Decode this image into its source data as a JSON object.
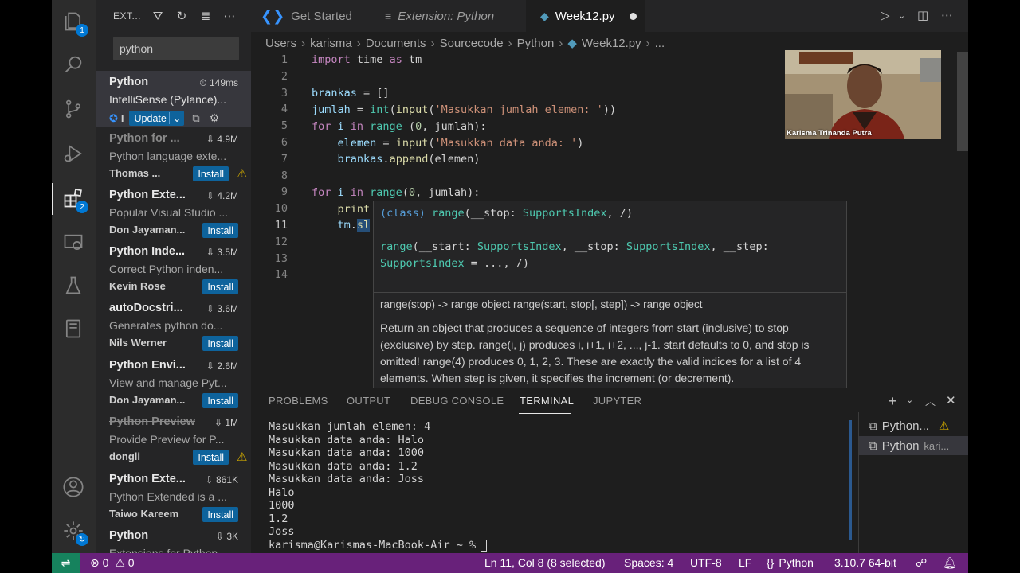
{
  "sidebar": {
    "title": "EXT...",
    "search": "python",
    "extensions": [
      {
        "name": "Python",
        "stat": "149ms",
        "desc": "IntelliSense (Pylance)...",
        "publisher": "I",
        "button": "Update",
        "selected": true,
        "strike": false,
        "warn": false
      },
      {
        "name": "Python for ...",
        "stat": "4.9M",
        "desc": "Python language exte...",
        "publisher": "Thomas ...",
        "button": "Install",
        "selected": false,
        "strike": true,
        "warn": true
      },
      {
        "name": "Python Exte...",
        "stat": "4.2M",
        "desc": "Popular Visual Studio ...",
        "publisher": "Don Jayaman...",
        "button": "Install",
        "selected": false,
        "strike": false,
        "warn": false
      },
      {
        "name": "Python Inde...",
        "stat": "3.5M",
        "desc": "Correct Python inden...",
        "publisher": "Kevin Rose",
        "button": "Install",
        "selected": false,
        "strike": false,
        "warn": false
      },
      {
        "name": "autoDocstri...",
        "stat": "3.6M",
        "desc": "Generates python do...",
        "publisher": "Nils Werner",
        "button": "Install",
        "selected": false,
        "strike": false,
        "warn": false
      },
      {
        "name": "Python Envi...",
        "stat": "2.6M",
        "desc": "View and manage Pyt...",
        "publisher": "Don Jayaman...",
        "button": "Install",
        "selected": false,
        "strike": false,
        "warn": false
      },
      {
        "name": "Python Preview",
        "stat": "1M",
        "desc": "Provide Preview for P...",
        "publisher": "dongli",
        "button": "Install",
        "selected": false,
        "strike": true,
        "warn": true
      },
      {
        "name": "Python Exte...",
        "stat": "861K",
        "desc": "Python Extended is a ...",
        "publisher": "Taiwo Kareem",
        "button": "Install",
        "selected": false,
        "strike": false,
        "warn": false
      },
      {
        "name": "Python",
        "stat": "3K",
        "desc": "Extensions for Python",
        "publisher": "",
        "button": "",
        "selected": false,
        "strike": false,
        "warn": false
      }
    ]
  },
  "activity": {
    "badge_explorer": "1",
    "badge_extensions": "2"
  },
  "tabs": {
    "tab1": "Get Started",
    "tab2": "Extension: Python",
    "tab3": "Week12.py"
  },
  "breadcrumb": [
    "Users",
    "karisma",
    "Documents",
    "Sourcecode",
    "Python",
    "Week12.py",
    "..."
  ],
  "line_numbers": [
    "1",
    "2",
    "3",
    "4",
    "5",
    "6",
    "7",
    "8",
    "9",
    "10",
    "11",
    "12",
    "13",
    "14"
  ],
  "code": {
    "l1_kw": "import",
    "l1_mod": " time ",
    "l1_as": "as",
    "l1_alias": " tm",
    "l3_var": "brankas",
    "l3_rest": " = []",
    "l4_var": "jumlah",
    "l4_eq": " = ",
    "l4_int": "int",
    "l4_p1": "(",
    "l4_input": "input",
    "l4_p2": "(",
    "l4_str": "'Masukkan jumlah elemen: '",
    "l4_end": "))",
    "l5_for": "for",
    "l5_i": " i ",
    "l5_in": "in",
    "l5_range": " range",
    "l5_p": " (",
    "l5_num": "0",
    "l5_rest": ", jumlah):",
    "l6_var": "elemen",
    "l6_eq": " = ",
    "l6_input": "input",
    "l6_p": "(",
    "l6_str": "'Masukkan data anda: '",
    "l6_end": ")",
    "l7_obj": "brankas",
    "l7_dot": ".",
    "l7_fn": "append",
    "l7_rest": "(elemen)",
    "l9_for": "for",
    "l9_i": " i ",
    "l9_in": "in",
    "l9_range": " range",
    "l9_p": "(",
    "l9_num": "0",
    "l9_rest": ", jumlah):",
    "l10": "print",
    "l11_obj": "tm",
    "l11_dot": ".",
    "l11_sel": "sl"
  },
  "hover": {
    "sig1_a": "(class) ",
    "sig1_b": "range",
    "sig1_c": "(__stop: ",
    "sig1_d": "SupportsIndex",
    "sig1_e": ", /)",
    "sig2_a": "range",
    "sig2_b": "(__start: ",
    "sig2_c": "SupportsIndex",
    "sig2_d": ", __stop: ",
    "sig2_e": "SupportsIndex",
    "sig2_f": ", __step: ",
    "sig3_a": "SupportsIndex",
    "sig3_b": " = ..., /)",
    "doc1": "range(stop) -> range object range(start, stop[, step]) -> range object",
    "doc2": "Return an object that produces a sequence of integers from start (inclusive) to stop (exclusive) by step. range(i, j) produces i, i+1, i+2, ..., j-1. start defaults to 0, and stop is omitted! range(4) produces 0, 1, 2, 3. These are exactly the valid indices for a list of 4 elements. When step is given, it specifies the increment (or decrement)."
  },
  "webcam": {
    "caption": "Karisma Trinanda Putra"
  },
  "panel": {
    "tabs": [
      "PROBLEMS",
      "OUTPUT",
      "DEBUG CONSOLE",
      "TERMINAL",
      "JUPYTER"
    ],
    "terminal_lines": [
      "Masukkan jumlah elemen: 4",
      "Masukkan data anda: Halo",
      "Masukkan data anda: 1000",
      "Masukkan data anda: 1.2",
      "Masukkan data anda: Joss",
      "Halo",
      "1000",
      "1.2",
      "Joss",
      "karisma@Karismas-MacBook-Air ~ % "
    ],
    "terminal_list": [
      {
        "name": "Python...",
        "suffix": ""
      },
      {
        "name": "Python",
        "suffix": "kari..."
      }
    ]
  },
  "status": {
    "errors": "0",
    "warnings": "0",
    "position": "Ln 11, Col 8 (8 selected)",
    "spaces": "Spaces: 4",
    "encoding": "UTF-8",
    "eol": "LF",
    "language": "Python",
    "interpreter": "3.10.7 64-bit"
  },
  "colors": {
    "status_bar": "#68217a",
    "remote": "#16825d",
    "button": "#0e639c",
    "accent": "#0078d4"
  }
}
